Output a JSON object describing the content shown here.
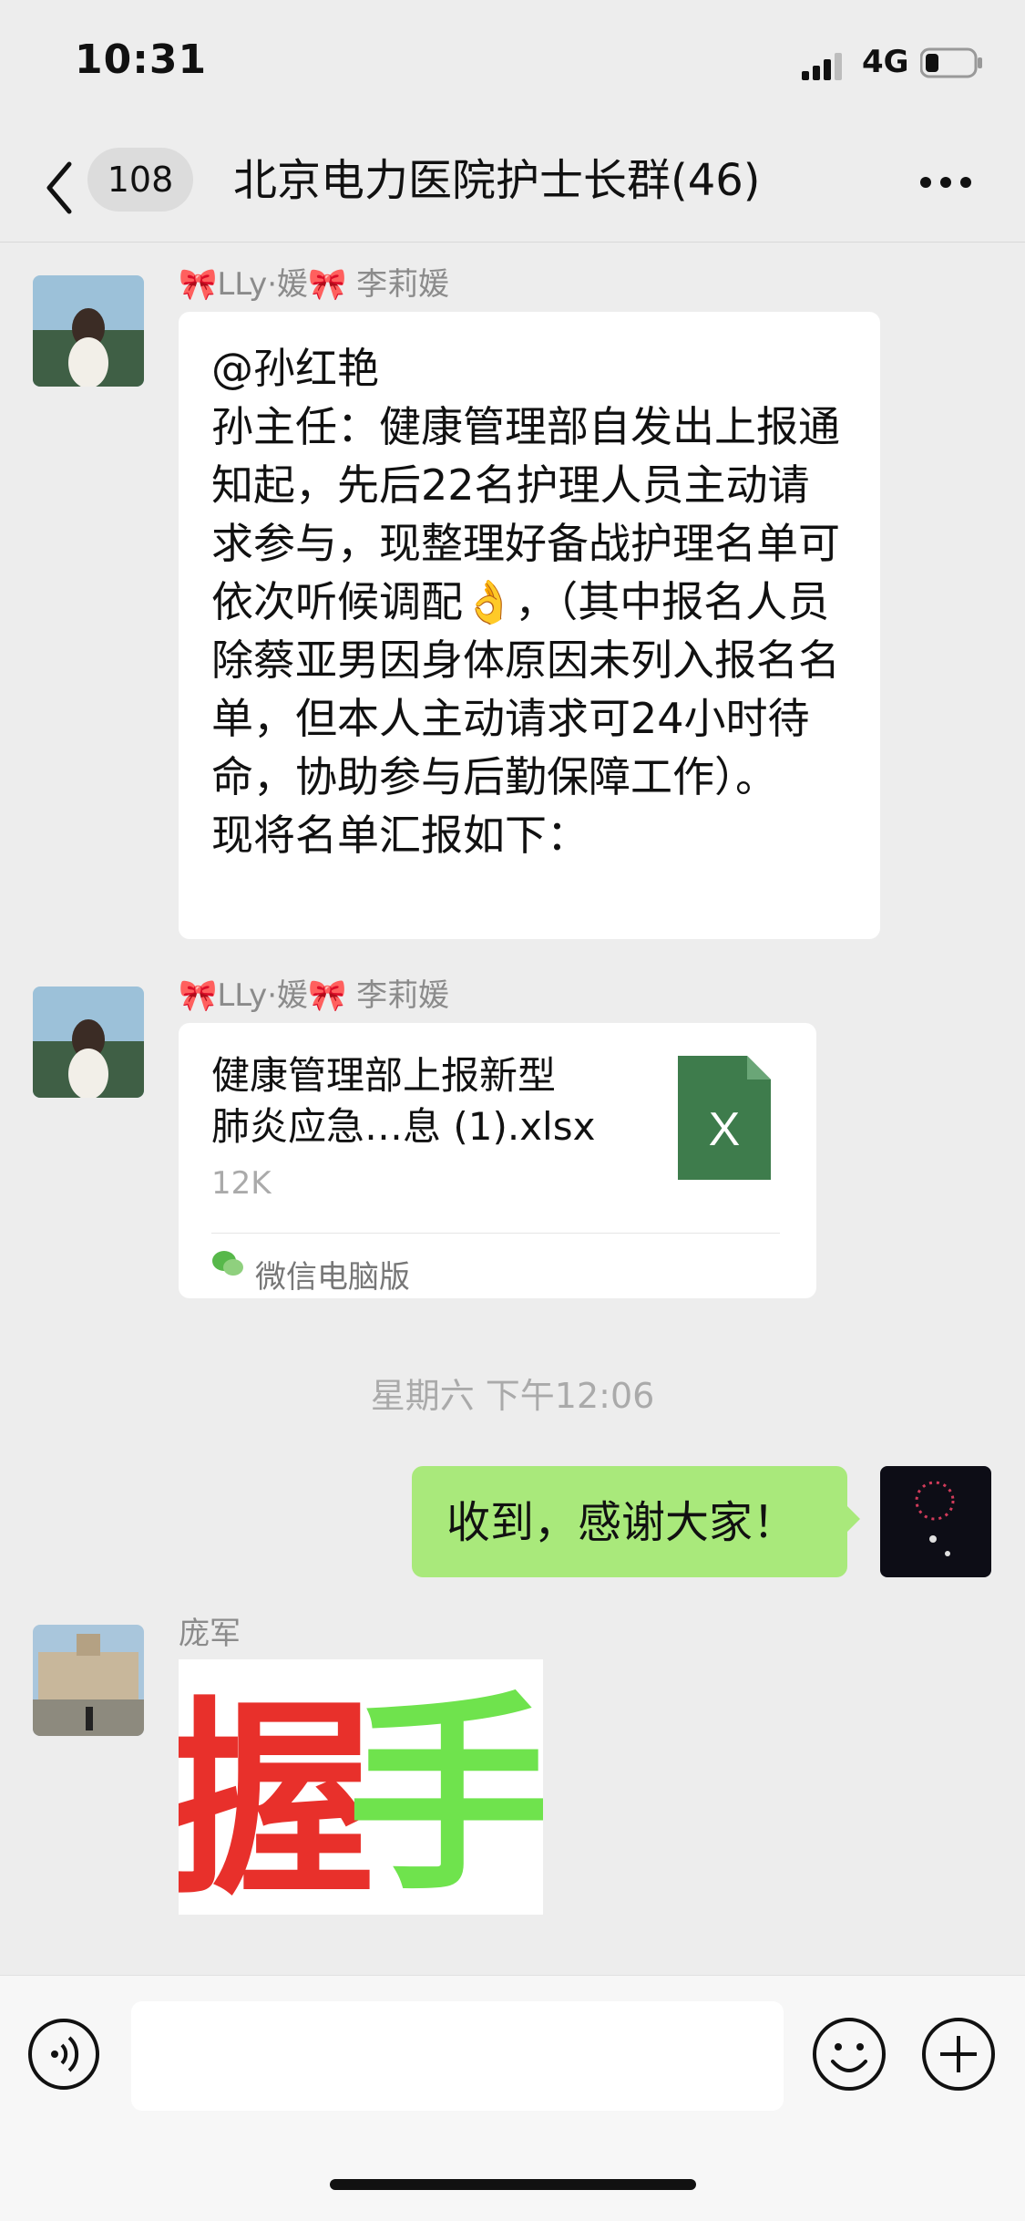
{
  "status_bar": {
    "time": "10:31",
    "network": "4G"
  },
  "nav": {
    "back_badge": "108",
    "title": "北京电力医院护士长群(46)"
  },
  "messages": [
    {
      "sender": "🎀LLy·媛🎀 李莉媛",
      "text": "@孙红艳\n孙主任：健康管理部自发出上报通知起，先后22名护理人员主动请求参与，现整理好备战护理名单可依次听候调配👌，（其中报名人员除蔡亚男因身体原因未列入报名名单，但本人主动请求可24小时待命，协助参与后勤保障工作）。\n现将名单汇报如下："
    },
    {
      "sender": "🎀LLy·媛🎀 李莉媛",
      "file_name": "健康管理部上报新型\n肺炎应急…息 (1).xlsx",
      "file_size": "12K",
      "file_source": "微信电脑版",
      "file_icon": "X"
    },
    {
      "timestamp": "星期六 下午12:06"
    },
    {
      "mine": true,
      "text": "收到，感谢大家！"
    },
    {
      "sender": "庞军",
      "sticker": "握手",
      "sticker_chars": [
        "握",
        "手"
      ]
    }
  ],
  "colors": {
    "sticker_red": "#e8302b",
    "sticker_green": "#6fe34d",
    "my_bubble": "#a9e97b",
    "excel": "#3e7c4c"
  },
  "icons": {
    "back": "chevron-left-icon",
    "more": "more-icon",
    "voice": "voice-icon",
    "emoji": "emoji-icon",
    "plus": "plus-icon",
    "excel": "excel-icon",
    "wechat": "wechat-icon"
  }
}
